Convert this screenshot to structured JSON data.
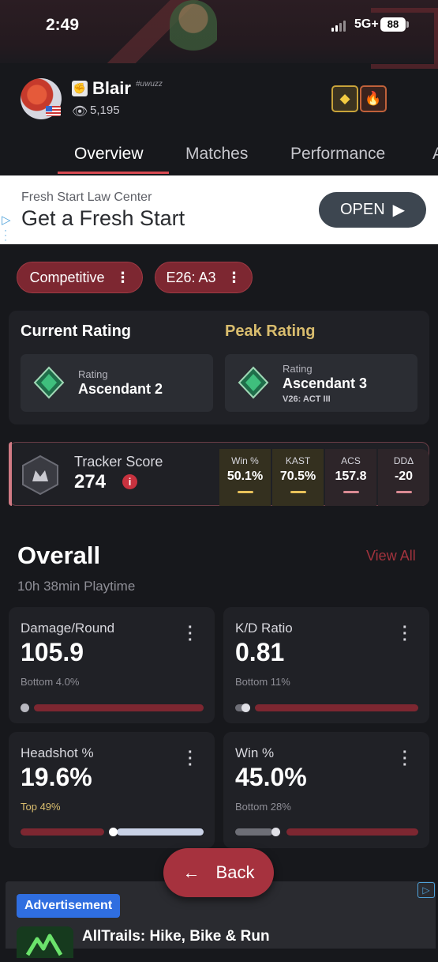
{
  "status_bar": {
    "time": "2:49",
    "network": "5G+",
    "battery": "88"
  },
  "profile": {
    "name": "Blair",
    "tag": "#uwuzz",
    "views": "5,195"
  },
  "tabs": [
    {
      "label": "Overview"
    },
    {
      "label": "Matches"
    },
    {
      "label": "Performance"
    },
    {
      "label": "A"
    }
  ],
  "ad_banner": {
    "subtitle": "Fresh Start Law Center",
    "title": "Get a Fresh Start",
    "button": "OPEN"
  },
  "filters": [
    {
      "label": "Competitive"
    },
    {
      "label": "E26: A3"
    }
  ],
  "current_rating": {
    "title": "Current Rating",
    "label": "Rating",
    "rank": "Ascendant 2"
  },
  "peak_rating": {
    "title": "Peak Rating",
    "label": "Rating",
    "rank": "Ascendant 3",
    "season": "V26: ACT III"
  },
  "tracker": {
    "label": "Tracker Score",
    "value": "274",
    "stats": [
      {
        "label": "Win %",
        "value": "50.1%",
        "color": "#e8c15a"
      },
      {
        "label": "KAST",
        "value": "70.5%",
        "color": "#e8c15a"
      },
      {
        "label": "ACS",
        "value": "157.8",
        "color": "#d98a93"
      },
      {
        "label": "DDΔ",
        "value": "-20",
        "color": "#d98a93"
      }
    ]
  },
  "overall": {
    "title": "Overall",
    "view_all": "View All",
    "playtime": "10h 38min Playtime",
    "cards": [
      {
        "label": "Damage/Round",
        "value": "105.9",
        "rank": "Bottom 4.0%",
        "percentile": 0.04
      },
      {
        "label": "K/D Ratio",
        "value": "0.81",
        "rank": "Bottom 11%",
        "percentile": 0.11
      },
      {
        "label": "Headshot %",
        "value": "19.6%",
        "rank": "Top 49%",
        "percentile": 0.51
      },
      {
        "label": "Win %",
        "value": "45.0%",
        "rank": "Bottom 28%",
        "percentile": 0.28
      }
    ]
  },
  "back_button": {
    "label": "Back"
  },
  "bottom_ad": {
    "badge": "Advertisement",
    "app_name": "AllTrails: Hike, Bike & Run"
  },
  "colors": {
    "accent_red": "#a6323e",
    "gold": "#d9bd6e",
    "bg": "#17181c",
    "card": "#202126"
  }
}
